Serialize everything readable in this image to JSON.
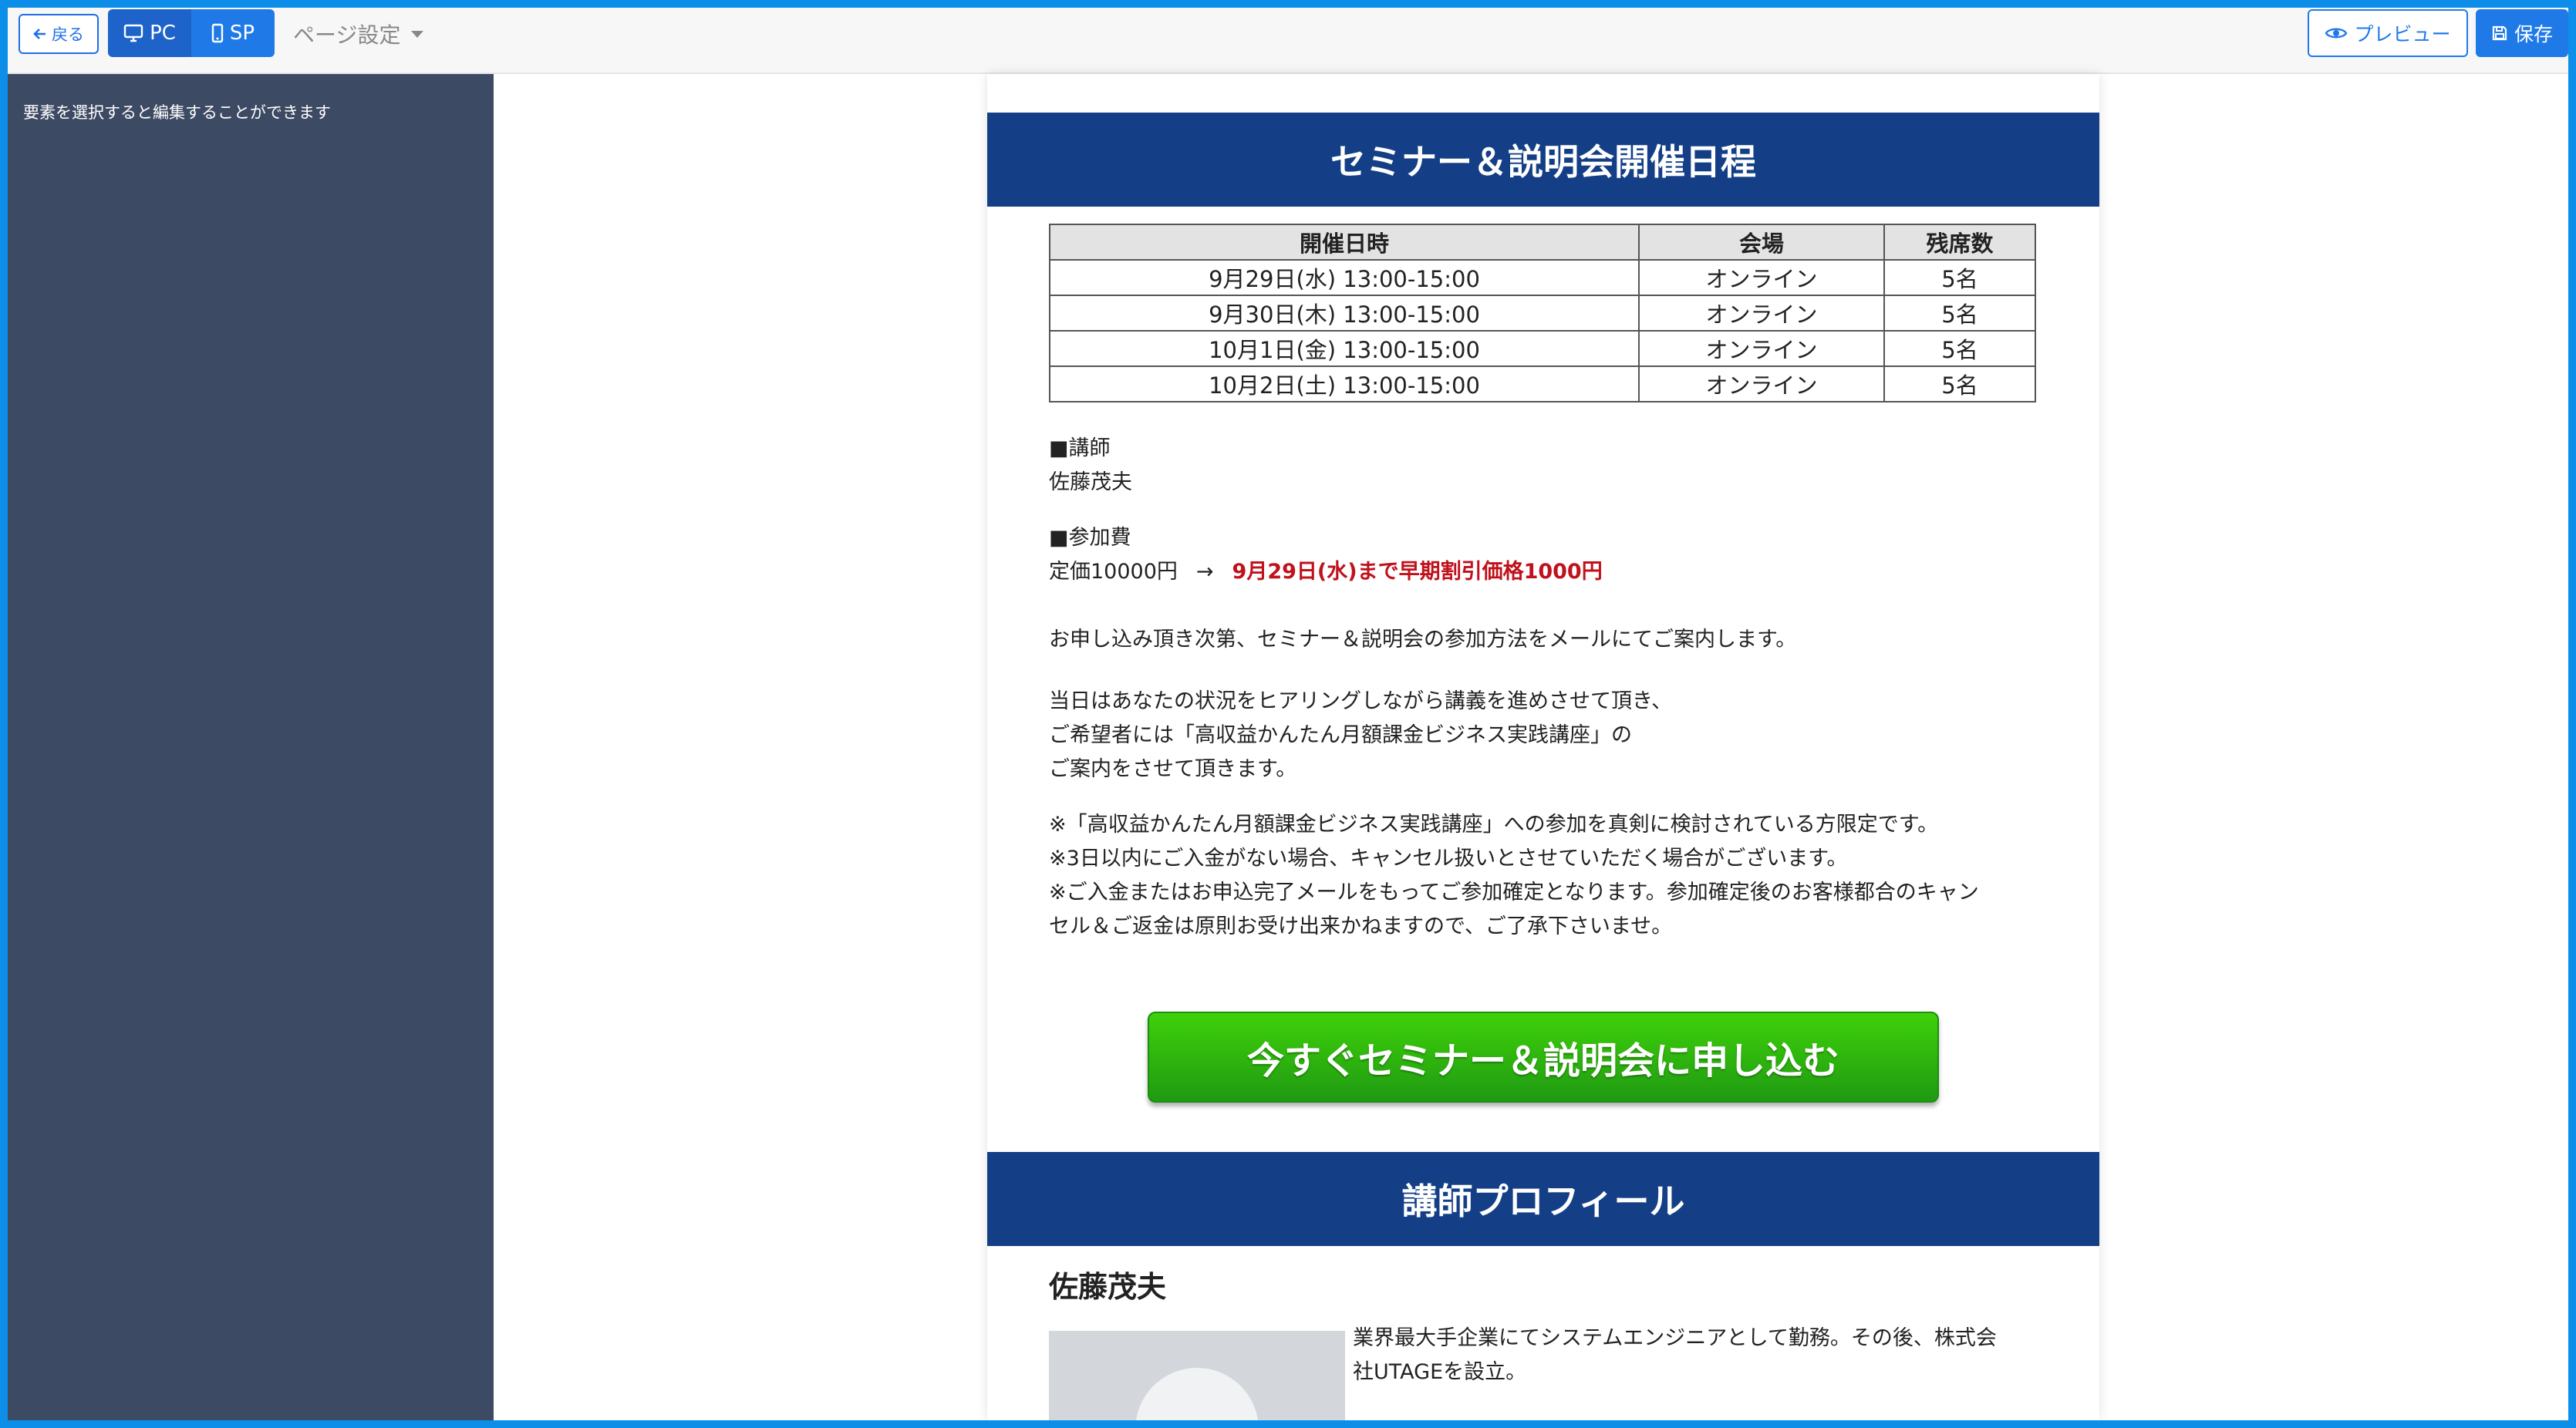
{
  "toolbar": {
    "back_label": "戻る",
    "pc_label": "PC",
    "sp_label": "SP",
    "page_settings_label": "ページ設定",
    "preview_label": "プレビュー",
    "save_label": "保存"
  },
  "sidebar": {
    "hint": "要素を選択すると編集することができます"
  },
  "schedule": {
    "heading": "セミナー＆説明会開催日程",
    "columns": [
      "開催日時",
      "会場",
      "残席数"
    ],
    "rows": [
      [
        "9月29日(水) 13:00-15:00",
        "オンライン",
        "5名"
      ],
      [
        "9月30日(木) 13:00-15:00",
        "オンライン",
        "5名"
      ],
      [
        "10月1日(金) 13:00-15:00",
        "オンライン",
        "5名"
      ],
      [
        "10月2日(土) 13:00-15:00",
        "オンライン",
        "5名"
      ]
    ]
  },
  "details": {
    "lecturer_label": "■講師",
    "lecturer_name": "佐藤茂夫",
    "fee_label": "■参加費",
    "fee_regular": "定価10000円",
    "fee_arrow": "→",
    "fee_early": "9月29日(水)まで早期割引価格1000円",
    "apply_note": "お申し込み頂き次第、セミナー＆説明会の参加方法をメールにてご案内します。",
    "day_lines": [
      "当日はあなたの状況をヒアリングしながら講義を進めさせて頂き、",
      "ご希望者には「高収益かんたん月額課金ビジネス実践講座」の",
      "ご案内をさせて頂きます。"
    ],
    "notes": [
      "※「高収益かんたん月額課金ビジネス実践講座」への参加を真剣に検討されている方限定です。",
      "※3日以内にご入金がない場合、キャンセル扱いとさせていただく場合がございます。",
      "※ご入金またはお申込完了メールをもってご参加確定となります。参加確定後のお客様都合のキャン",
      "セル＆ご返金は原則お受け出来かねますので、ご了承下さいませ。"
    ]
  },
  "cta": {
    "label": "今すぐセミナー＆説明会に申し込む"
  },
  "profile": {
    "heading": "講師プロフィール",
    "name": "佐藤茂夫",
    "bio_lines": [
      "業界最大手企業にてシステムエンジニアとして勤務。その後、株式会",
      "社UTAGEを設立。"
    ]
  }
}
